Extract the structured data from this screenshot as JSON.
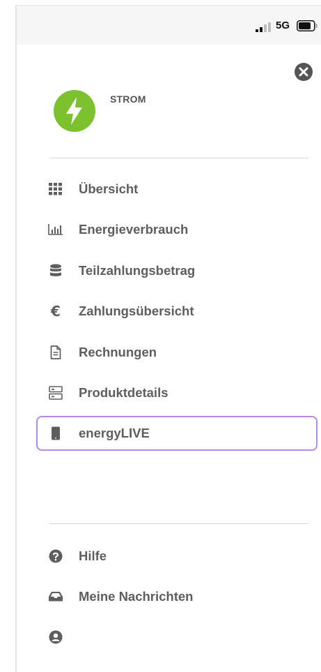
{
  "statusbar": {
    "network": "5G",
    "icons": [
      "signal-icon",
      "battery-icon"
    ]
  },
  "header": {
    "title": "STROM",
    "logo_icon": "lightning-bolt-icon",
    "logo_color": "#7cc12e",
    "close_icon": "close-circle-icon"
  },
  "menu": {
    "items": [
      {
        "label": "Übersicht",
        "icon": "grid-icon"
      },
      {
        "label": "Energieverbrauch",
        "icon": "bar-chart-icon"
      },
      {
        "label": "Teilzahlungsbetrag",
        "icon": "database-icon"
      },
      {
        "label": "Zahlungsübersicht",
        "icon": "euro-icon",
        "glyph": "€"
      },
      {
        "label": "Rechnungen",
        "icon": "document-icon"
      },
      {
        "label": "Produktdetails",
        "icon": "server-icon"
      },
      {
        "label": "energyLIVE",
        "icon": "mobile-device-icon",
        "active": true
      }
    ]
  },
  "footer_menu": {
    "items": [
      {
        "label": "Hilfe",
        "icon": "help-circle-icon"
      },
      {
        "label": "Meine Nachrichten",
        "icon": "inbox-icon"
      },
      {
        "label": "",
        "icon": "user-circle-icon"
      }
    ]
  },
  "colors": {
    "accent": "#b38be3",
    "text": "#5e5e5e",
    "brand_green": "#7cc12e"
  }
}
